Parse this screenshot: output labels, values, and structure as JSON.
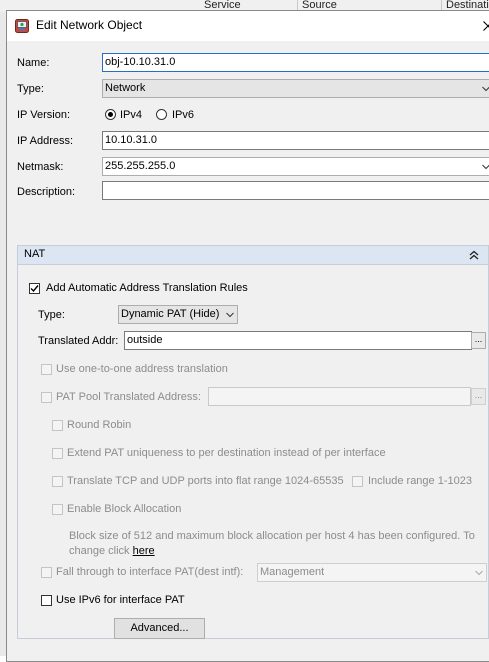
{
  "background_table": {
    "columns": [
      "Service",
      "Source",
      "Destinati"
    ]
  },
  "dialog": {
    "title": "Edit Network Object",
    "close_glyph": "✕"
  },
  "form": {
    "name_label": "Name:",
    "name_value": "obj-10.10.31.0",
    "type_label": "Type:",
    "type_value": "Network",
    "ip_version_label": "IP Version:",
    "ipv4_label": "IPv4",
    "ipv6_label": "IPv6",
    "ip_version_selected": "IPv4",
    "ip_address_label": "IP Address:",
    "ip_address_value": "10.10.31.0",
    "netmask_label": "Netmask:",
    "netmask_value": "255.255.255.0",
    "description_label": "Description:",
    "description_value": ""
  },
  "nat": {
    "title": "NAT",
    "add_rules_label": "Add Automatic Address Translation Rules",
    "add_rules_checked": true,
    "type_label": "Type:",
    "type_value": "Dynamic PAT (Hide)",
    "translated_addr_label": "Translated Addr:",
    "translated_addr_value": "outside",
    "browse_glyph": "...",
    "one_to_one_label": "Use one-to-one address translation",
    "pat_pool_label": "PAT Pool Translated Address:",
    "pat_pool_value": "",
    "round_robin_label": "Round Robin",
    "extend_pat_label": "Extend PAT uniqueness to per destination instead of per interface",
    "translate_tcp_udp_label": "Translate TCP and UDP ports into flat range 1024-65535",
    "include_range_label": "Include range 1-1023",
    "block_allocation_label": "Enable Block Allocation",
    "block_info_line1": "Block size of 512 and maximum block allocation per host 4 has been configured. To",
    "block_info_line2_prefix": "change click ",
    "block_info_link": "here",
    "fall_through_label": "Fall through to interface PAT(dest intf):",
    "fall_through_value": "Management",
    "ipv6_pat_label": "Use IPv6 for interface PAT",
    "ipv6_pat_checked": false,
    "advanced_button": "Advanced..."
  },
  "colors": {
    "dialog_bg": "#f0f0f0",
    "nat_header_bg": "#dce6f3",
    "disabled_text": "#8c8c8c"
  },
  "icons": {
    "title": "asdm-network-object-icon",
    "dropdown": "chevron-down-icon",
    "collapse": "double-chevron-up-icon",
    "checkmark": "checkmark-icon"
  }
}
